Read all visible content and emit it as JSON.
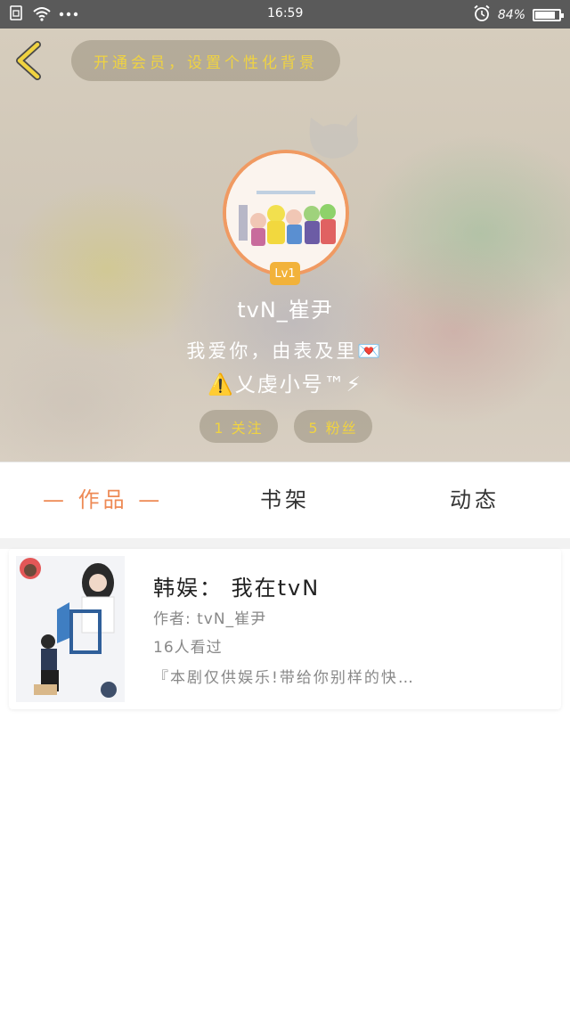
{
  "status_bar": {
    "time": "16:59",
    "battery_percent": "84%",
    "battery_level": 0.84,
    "icons": [
      "sim-icon",
      "wifi-icon",
      "more-dots-icon",
      "alarm-icon",
      "battery-icon"
    ]
  },
  "header": {
    "back_icon": "chevron-left-icon",
    "vip_prompt": "开通会员，设置个性化背景",
    "level": "Lv1",
    "username": "tvN_崔尹",
    "signature": "我爱你，由表及里💌",
    "tagline": "⚠️乂虔小号™⚡",
    "follow_label": "1 关注",
    "fans_label": "5 粉丝"
  },
  "tabs": [
    {
      "label": "— 作品 —",
      "active": true
    },
    {
      "label": "书架",
      "active": false
    },
    {
      "label": "动态",
      "active": false
    }
  ],
  "book": {
    "title": "韩娱： 我在tvN",
    "author": "作者: tvN_崔尹",
    "views": "16人看过",
    "description": "『本剧仅供娱乐!带给你别样的快…"
  },
  "colors": {
    "accent": "#ee8a55",
    "gold_text": "#f0d341",
    "level_badge": "#f2b23a",
    "status_bar": "#5a5a5a"
  }
}
